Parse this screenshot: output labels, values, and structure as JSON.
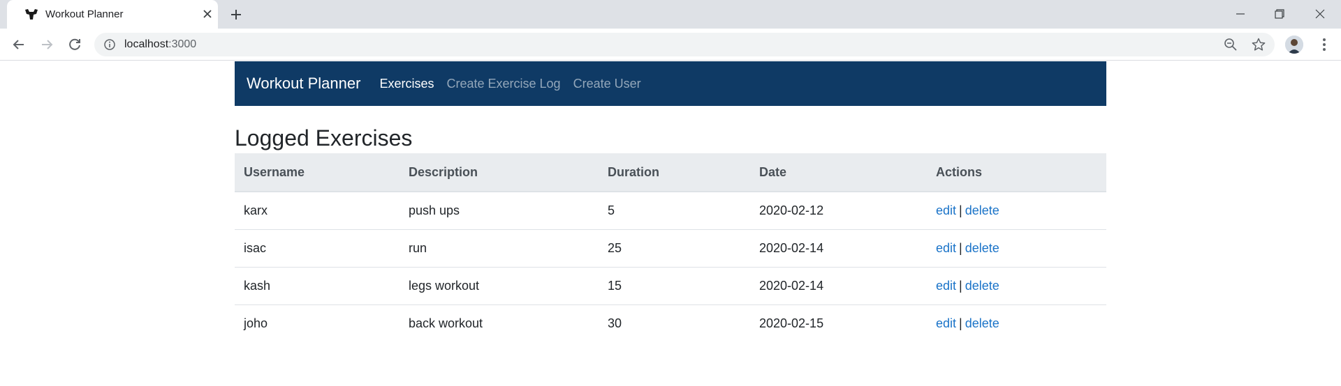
{
  "browser": {
    "tab_title": "Workout Planner",
    "url_host": "localhost",
    "url_port": ":3000",
    "icons": [
      "dumbbell-icon",
      "close-icon",
      "plus-icon",
      "back-arrow-icon",
      "forward-arrow-icon",
      "reload-icon",
      "info-icon",
      "zoom-out-icon",
      "star-icon",
      "menu-dots-icon"
    ]
  },
  "navbar": {
    "brand": "Workout Planner",
    "links": [
      {
        "label": "Exercises",
        "active": true
      },
      {
        "label": "Create Exercise Log",
        "active": false
      },
      {
        "label": "Create User",
        "active": false
      }
    ],
    "bg_color": "#0f3a65"
  },
  "page": {
    "title": "Logged Exercises"
  },
  "table": {
    "headers": [
      "Username",
      "Description",
      "Duration",
      "Date",
      "Actions"
    ],
    "rows": [
      {
        "username": "karx",
        "description": "push ups",
        "duration": "5",
        "date": "2020-02-12"
      },
      {
        "username": "isac",
        "description": "run",
        "duration": "25",
        "date": "2020-02-14"
      },
      {
        "username": "kash",
        "description": "legs workout",
        "duration": "15",
        "date": "2020-02-14"
      },
      {
        "username": "joho",
        "description": "back workout",
        "duration": "30",
        "date": "2020-02-15"
      }
    ],
    "actions": {
      "edit": "edit",
      "separator": "|",
      "delete": "delete"
    },
    "link_color": "#1a73c8"
  }
}
